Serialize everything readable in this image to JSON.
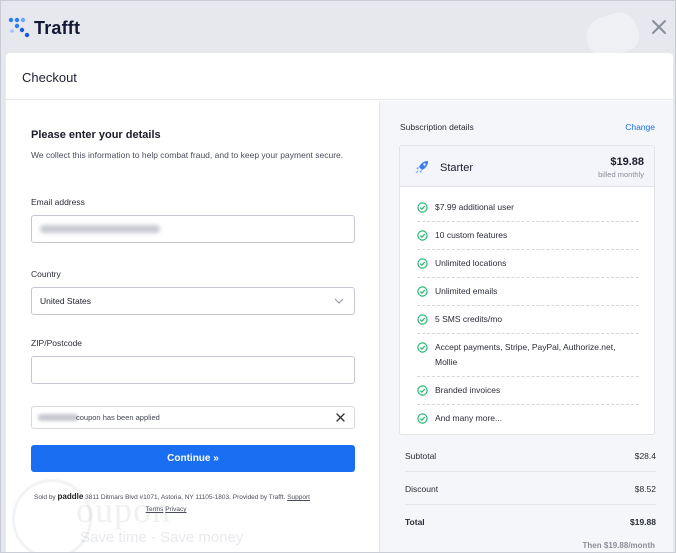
{
  "brand": {
    "name": "Trafft"
  },
  "header": {
    "title": "Checkout"
  },
  "form": {
    "title": "Please enter your details",
    "description": "We collect this information to help combat fraud, and to keep your payment secure.",
    "email_label": "Email address",
    "country_label": "Country",
    "country_value": "United States",
    "zip_label": "ZIP/Postcode",
    "zip_value": "",
    "coupon_text": "coupon has been applied",
    "continue_label": "Continue »",
    "soldby": {
      "prefix": "Sold by",
      "vendor": "paddle",
      "address": "3811 Ditmars Blvd #1071, Astoria, NY 11105-1803. Provided by Trafft.",
      "support": "Support",
      "terms": "Terms",
      "privacy": "Privacy"
    }
  },
  "watermark": {
    "big": "oupon",
    "small": "Save time - Save money"
  },
  "subscription": {
    "heading": "Subscription details",
    "change_label": "Change",
    "plan_name": "Starter",
    "price": "$19.88",
    "billing": "billed monthly",
    "features": [
      "$7.99 additional user",
      "10 custom features",
      "Unlimited locations",
      "Unlimited emails",
      "5 SMS credits/mo",
      "Accept payments, Stripe, PayPal, Authorize.net, Mollie",
      "Branded invoices",
      "And many more..."
    ],
    "subtotal_label": "Subtotal",
    "subtotal_value": "$28.4",
    "discount_label": "Discount",
    "discount_value": "$8.52",
    "total_label": "Total",
    "total_value": "$19.88",
    "then_text": "Then $19.88/month"
  },
  "colors": {
    "accent": "#1a6ef2",
    "check": "#2bb673"
  },
  "icons": {
    "logo": "trafft-logo-icon",
    "close": "close-icon",
    "plan": "rocket-icon",
    "check": "check-circle-icon",
    "chevron": "chevron-down-icon",
    "remove": "close-icon"
  }
}
